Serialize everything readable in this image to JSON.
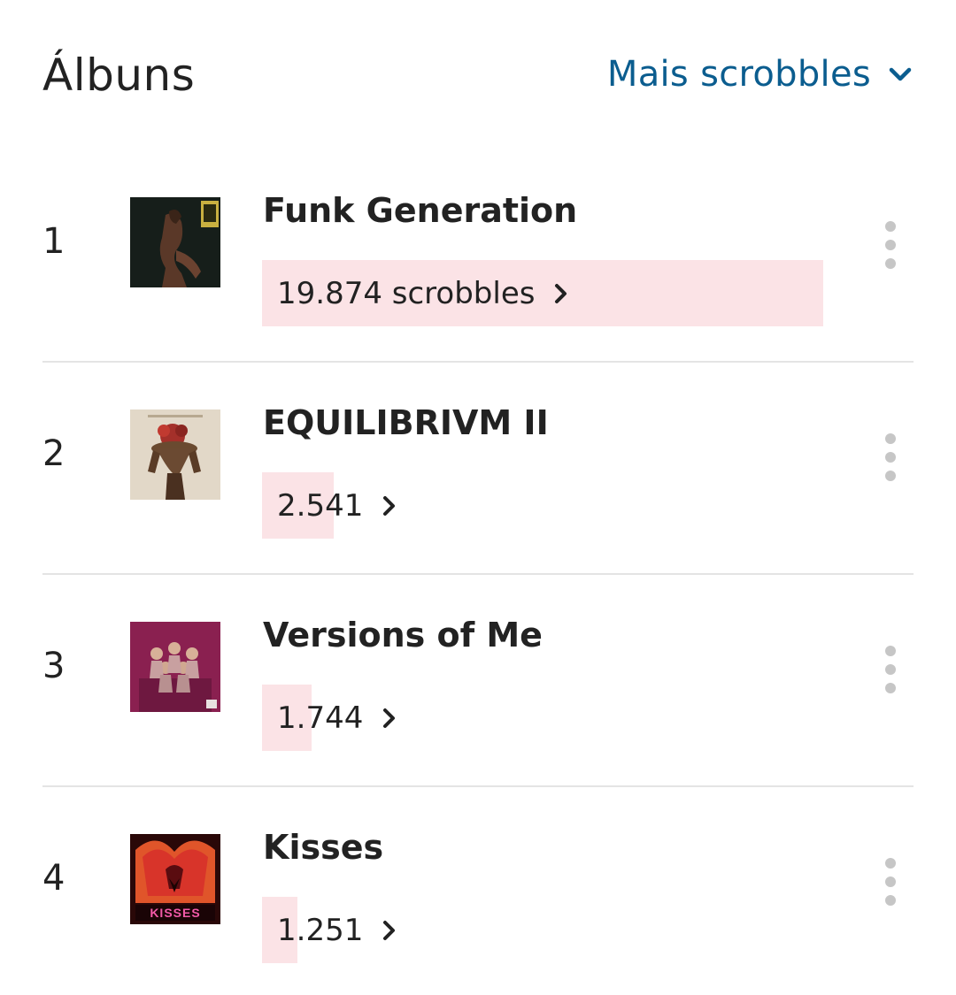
{
  "header": {
    "title": "Álbuns",
    "sort_label": "Mais scrobbles",
    "sort_icon": "chevron-down-icon"
  },
  "colors": {
    "accent": "#0b5d8f",
    "bar": "#fbe3e6",
    "divider": "#e4e4e4",
    "dots": "#c6c6c6"
  },
  "albums": [
    {
      "rank": "1",
      "name": "Funk Generation",
      "scrobbles": "19.874 scrobbles",
      "bar_fraction": 1.0
    },
    {
      "rank": "2",
      "name": "EQUILIBRIVM II",
      "scrobbles": "2.541",
      "bar_fraction": 0.128
    },
    {
      "rank": "3",
      "name": "Versions of Me",
      "scrobbles": "1.744",
      "bar_fraction": 0.088
    },
    {
      "rank": "4",
      "name": "Kisses",
      "scrobbles": "1.251",
      "bar_fraction": 0.063
    }
  ]
}
